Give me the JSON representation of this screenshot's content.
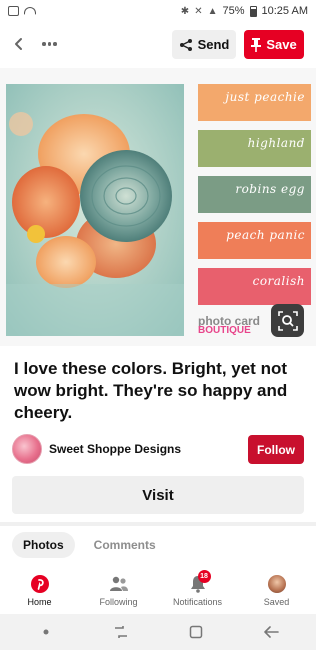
{
  "status_bar": {
    "battery": "75%",
    "time": "10:25 AM"
  },
  "toolbar": {
    "send_label": "Send",
    "save_label": "Save"
  },
  "palette": [
    {
      "label": "just peachie",
      "color": "#f3a86c"
    },
    {
      "label": "highland",
      "color": "#9bb06f"
    },
    {
      "label": "robins egg",
      "color": "#7b9c85"
    },
    {
      "label": "peach panic",
      "color": "#ef7e58"
    },
    {
      "label": "coralish",
      "color": "#e8606d"
    }
  ],
  "watermark": {
    "line1": "photo card",
    "line2": "BOUTIQUE"
  },
  "pin": {
    "description": "I love these colors.  Bright, yet not wow bright.  They're so happy and cheery."
  },
  "creator": {
    "name": "Sweet Shoppe Designs",
    "follow_label": "Follow"
  },
  "visit_label": "Visit",
  "tabs": [
    {
      "label": "Photos",
      "active": true
    },
    {
      "label": "Comments",
      "active": false
    }
  ],
  "nav": {
    "items": [
      {
        "label": "Home",
        "icon": "pinterest-logo-icon",
        "active": true
      },
      {
        "label": "Following",
        "icon": "people-icon",
        "active": false
      },
      {
        "label": "Notifications",
        "icon": "bell-icon",
        "active": false,
        "badge": "18"
      },
      {
        "label": "Saved",
        "icon": "profile-avatar-icon",
        "active": false
      }
    ]
  },
  "colors": {
    "accent": "#e60023",
    "follow": "#c8102e",
    "surface": "#efefef"
  }
}
